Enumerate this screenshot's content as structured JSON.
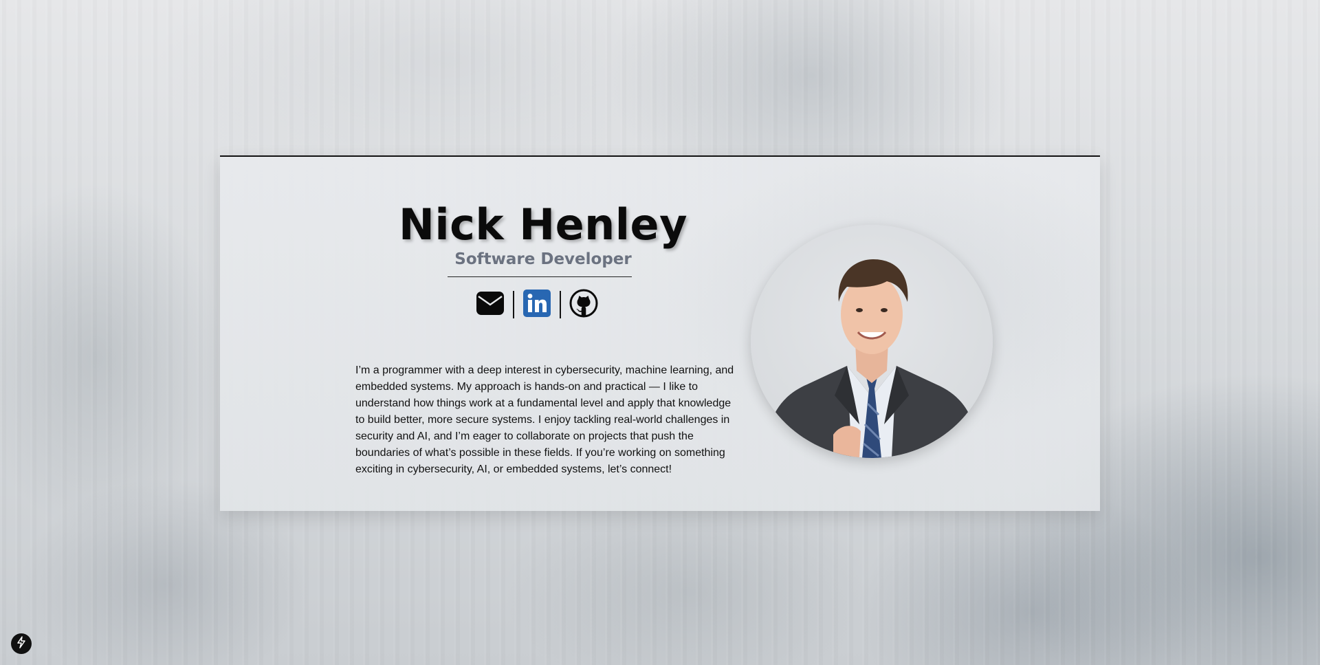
{
  "profile": {
    "name": "Nick Henley",
    "role": "Software Developer",
    "bio": "I’m a programmer with a deep interest in cybersecurity, machine learning, and embedded systems. My approach is hands-on and practical — I like to understand how things work at a fundamental level and apply that knowledge to build better, more secure systems. I enjoy tackling real-world challenges in security and AI, and I’m eager to collaborate on projects that push the boundaries of what’s possible in these fields. If you’re working on something exciting in cybersecurity, AI, or embedded systems, let’s connect!"
  },
  "social": {
    "icons": [
      "envelope-icon",
      "linkedin-icon",
      "github-icon"
    ],
    "linkedin_color": "#2867b2"
  },
  "dev_indicator": {
    "icon": "lightning-bolt-icon"
  }
}
